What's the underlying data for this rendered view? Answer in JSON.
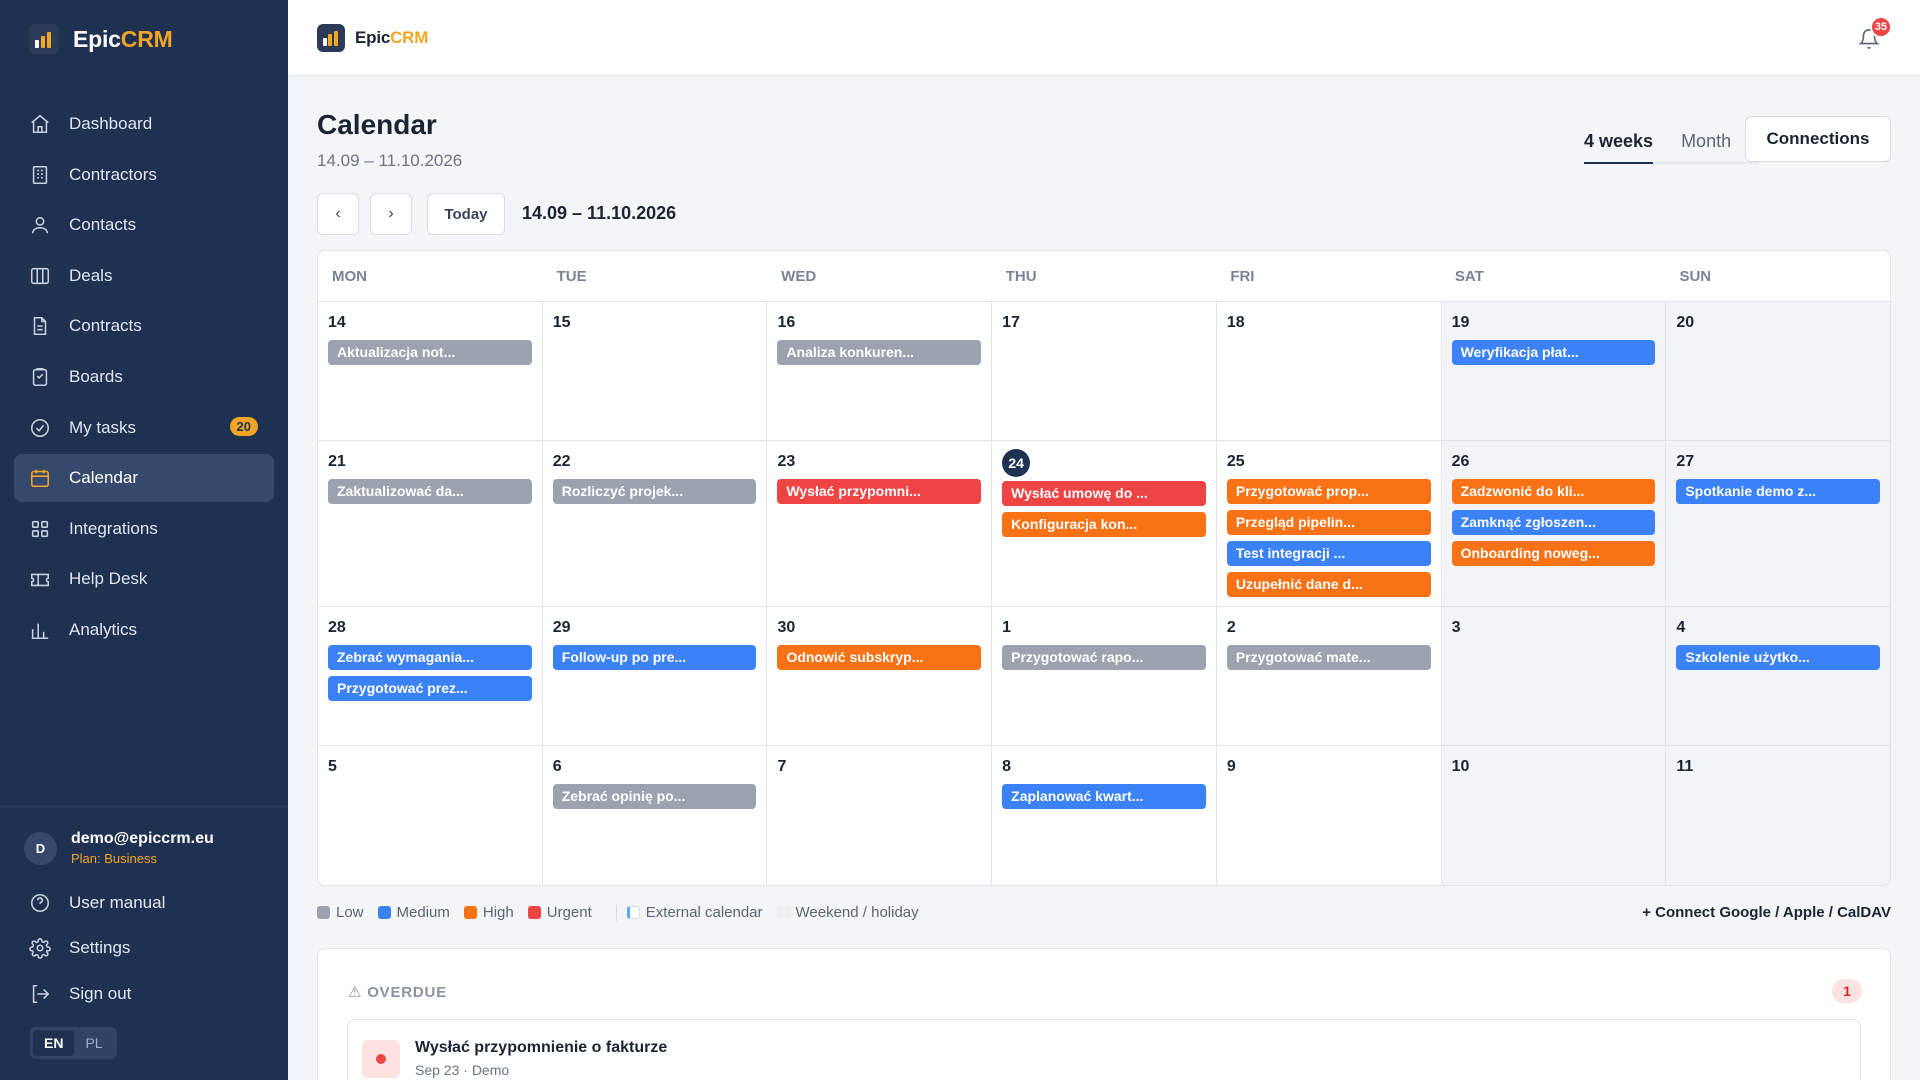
{
  "brand": {
    "name_main": "Epic",
    "name_accent": "CRM"
  },
  "sidebar": {
    "items": [
      {
        "label": "Dashboard",
        "icon": "home-icon",
        "active": false
      },
      {
        "label": "Contractors",
        "icon": "building-icon",
        "active": false
      },
      {
        "label": "Contacts",
        "icon": "user-icon",
        "active": false
      },
      {
        "label": "Deals",
        "icon": "columns-icon",
        "active": false
      },
      {
        "label": "Contracts",
        "icon": "file-icon",
        "active": false
      },
      {
        "label": "Boards",
        "icon": "clipboard-icon",
        "active": false
      },
      {
        "label": "My tasks",
        "icon": "check-circle-icon",
        "active": false,
        "badge": "20"
      },
      {
        "label": "Calendar",
        "icon": "calendar-icon",
        "active": true
      },
      {
        "label": "Integrations",
        "icon": "grid-icon",
        "active": false
      },
      {
        "label": "Help Desk",
        "icon": "ticket-icon",
        "active": false
      },
      {
        "label": "Analytics",
        "icon": "bar-chart-icon",
        "active": false
      }
    ],
    "user": {
      "initial": "D",
      "email": "demo@epiccrm.eu",
      "plan": "Plan: Business"
    },
    "footer": [
      {
        "label": "User manual",
        "icon": "help-circle-icon"
      },
      {
        "label": "Settings",
        "icon": "gear-icon"
      },
      {
        "label": "Sign out",
        "icon": "sign-out-icon"
      }
    ],
    "languages": [
      {
        "code": "EN",
        "active": true
      },
      {
        "code": "PL",
        "active": false
      }
    ]
  },
  "topbar": {
    "notifications": "35"
  },
  "page": {
    "title": "Calendar",
    "subtitle": "14.09 – 11.10.2026",
    "views": [
      {
        "label": "4 weeks",
        "active": true
      },
      {
        "label": "Month",
        "active": false
      }
    ],
    "connections_label": "Connections",
    "prev_label": "‹",
    "next_label": "›",
    "today_label": "Today",
    "range": "14.09 – 11.10.2026"
  },
  "calendar": {
    "weekdays": [
      "MON",
      "TUE",
      "WED",
      "THU",
      "FRI",
      "SAT",
      "SUN"
    ],
    "weeks": [
      [
        {
          "day": "14",
          "events": [
            {
              "title": "Aktualizacja not...",
              "priority": "low"
            }
          ]
        },
        {
          "day": "15",
          "events": []
        },
        {
          "day": "16",
          "events": [
            {
              "title": "Analiza konkuren...",
              "priority": "low"
            }
          ]
        },
        {
          "day": "17",
          "events": []
        },
        {
          "day": "18",
          "events": []
        },
        {
          "day": "19",
          "weekend": true,
          "events": [
            {
              "title": "Weryfikacja płat...",
              "priority": "medium"
            }
          ]
        },
        {
          "day": "20",
          "weekend": true,
          "events": []
        }
      ],
      [
        {
          "day": "21",
          "events": [
            {
              "title": "Zaktualizować da...",
              "priority": "low"
            }
          ]
        },
        {
          "day": "22",
          "events": [
            {
              "title": "Rozliczyć projek...",
              "priority": "low"
            }
          ]
        },
        {
          "day": "23",
          "events": [
            {
              "title": "Wysłać przypomni...",
              "priority": "urgent"
            }
          ]
        },
        {
          "day": "24",
          "today": true,
          "events": [
            {
              "title": "Wysłać umowę do ...",
              "priority": "urgent"
            },
            {
              "title": "Konfiguracja kon...",
              "priority": "high"
            }
          ]
        },
        {
          "day": "25",
          "events": [
            {
              "title": "Przygotować prop...",
              "priority": "high"
            },
            {
              "title": "Przegląd pipelin...",
              "priority": "high"
            },
            {
              "title": "Test integracji ...",
              "priority": "medium"
            },
            {
              "title": "Uzupełnić dane d...",
              "priority": "high"
            }
          ]
        },
        {
          "day": "26",
          "weekend": true,
          "events": [
            {
              "title": "Zadzwonić do kli...",
              "priority": "high"
            },
            {
              "title": "Zamknąć zgłoszen...",
              "priority": "medium"
            },
            {
              "title": "Onboarding noweg...",
              "priority": "high"
            }
          ]
        },
        {
          "day": "27",
          "weekend": true,
          "events": [
            {
              "title": "Spotkanie demo z...",
              "priority": "medium"
            }
          ]
        }
      ],
      [
        {
          "day": "28",
          "events": [
            {
              "title": "Zebrać wymagania...",
              "priority": "medium"
            },
            {
              "title": "Przygotować prez...",
              "priority": "medium"
            }
          ]
        },
        {
          "day": "29",
          "events": [
            {
              "title": "Follow-up po pre...",
              "priority": "medium"
            }
          ]
        },
        {
          "day": "30",
          "events": [
            {
              "title": "Odnowić subskryp...",
              "priority": "high"
            }
          ]
        },
        {
          "day": "1",
          "events": [
            {
              "title": "Przygotować rapo...",
              "priority": "low"
            }
          ]
        },
        {
          "day": "2",
          "events": [
            {
              "title": "Przygotować mate...",
              "priority": "low"
            }
          ]
        },
        {
          "day": "3",
          "weekend": true,
          "events": []
        },
        {
          "day": "4",
          "weekend": true,
          "events": [
            {
              "title": "Szkolenie użytko...",
              "priority": "medium"
            }
          ]
        }
      ],
      [
        {
          "day": "5",
          "events": []
        },
        {
          "day": "6",
          "events": [
            {
              "title": "Zebrać opinię po...",
              "priority": "low"
            }
          ]
        },
        {
          "day": "7",
          "events": []
        },
        {
          "day": "8",
          "events": [
            {
              "title": "Zaplanować kwart...",
              "priority": "medium"
            }
          ]
        },
        {
          "day": "9",
          "events": []
        },
        {
          "day": "10",
          "weekend": true,
          "events": []
        },
        {
          "day": "11",
          "weekend": true,
          "events": []
        }
      ]
    ]
  },
  "legend": {
    "items": [
      {
        "label": "Low",
        "color": "#9ca3af"
      },
      {
        "label": "Medium",
        "color": "#3b82f6"
      },
      {
        "label": "High",
        "color": "#f97316"
      },
      {
        "label": "Urgent",
        "color": "#ef4444"
      }
    ],
    "external": "External calendar",
    "weekend": "Weekend / holiday",
    "connect": "+ Connect Google / Apple / CalDAV"
  },
  "overdue": {
    "title": "⚠ OVERDUE",
    "count": "1",
    "items": [
      {
        "title": "Wysłać przypomnienie o fakturze",
        "meta": "Sep 23 · Demo"
      }
    ]
  }
}
